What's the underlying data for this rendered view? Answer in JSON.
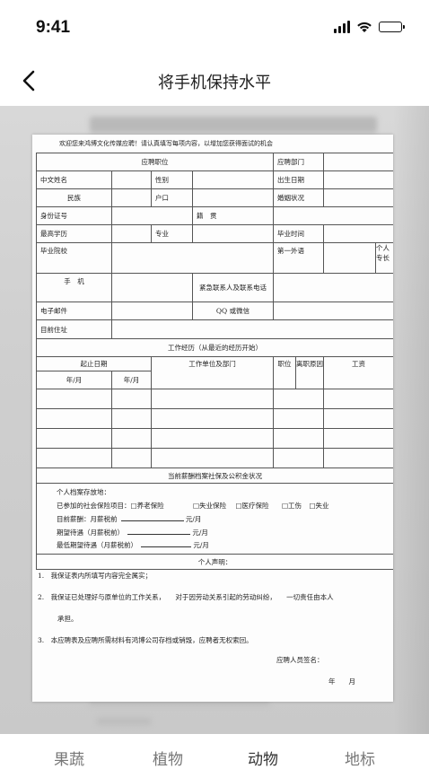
{
  "status": {
    "time": "9:41",
    "icons": [
      "signal-icon",
      "wifi-icon",
      "battery-icon"
    ]
  },
  "nav": {
    "title": "将手机保持水平",
    "back_icon": "chevron-left-icon"
  },
  "document": {
    "intro": "欢迎您来鸿博文化传媒应聘！请认真填写每项内容，以增加您获得面试的机会",
    "fields": {
      "position": "应聘职位",
      "department": "应聘部门",
      "chinese_name": "中文姓名",
      "gender": "性别",
      "birth_date": "出生日期",
      "ethnicity": "民族",
      "hukou": "户口",
      "marital": "婚姻状况",
      "id_number": "身份证号",
      "native_place": "籍　贯",
      "education": "最高学历",
      "major": "专业",
      "grad_time": "毕业时间",
      "school": "毕业院校",
      "foreign_lang": "第一外语",
      "personal_short": "个人",
      "specialty_short": "专长",
      "mobile": "手　机",
      "emergency": "紧急联系人及联系电话",
      "email": "电子邮件",
      "qq": "QQ 或微信",
      "address": "目前住址"
    },
    "work": {
      "title": "工作经历（从最近的经历开始）",
      "start_end": "起止日期",
      "company": "工作单位及部门",
      "post": "职位",
      "leave_reason": "离职原因",
      "salary": "工资",
      "year_month_1": "年/月",
      "year_month_2": "年/月"
    },
    "insurance": {
      "title": "当前薪酬档案社保及公积金状况",
      "archive": "个人档案存放地：",
      "social_prefix": "已参加的社会保险项目：",
      "pension": "□养老保险",
      "unemployment": "□失业保险",
      "medical": "□医疗保险",
      "injury": "□工伤",
      "other": "□失业",
      "current_salary": "目前薪酬：月薪税前",
      "expected": "期望待遇（月薪税前）",
      "minimum": "最低期望待遇（月薪税前）",
      "unit": "元/月"
    },
    "declaration": {
      "title": "个人声明：",
      "item1": "1.　我保证表内所填写内容完全属实；",
      "item2": "2.　我保证已处理好与原单位的工作关系，　　对于因劳动关系引起的劳动纠纷，　　一切责任由本人",
      "item2b": "承担。",
      "item3": "3.　本应聘表及应聘所需材料有鸿博公司存档或销毁，应聘者无权索回。",
      "signature": "应聘人员签名：",
      "date": "年　　月"
    }
  },
  "tabs": [
    {
      "label": "果蔬"
    },
    {
      "label": "植物"
    },
    {
      "label": "动物"
    },
    {
      "label": "地标"
    }
  ]
}
